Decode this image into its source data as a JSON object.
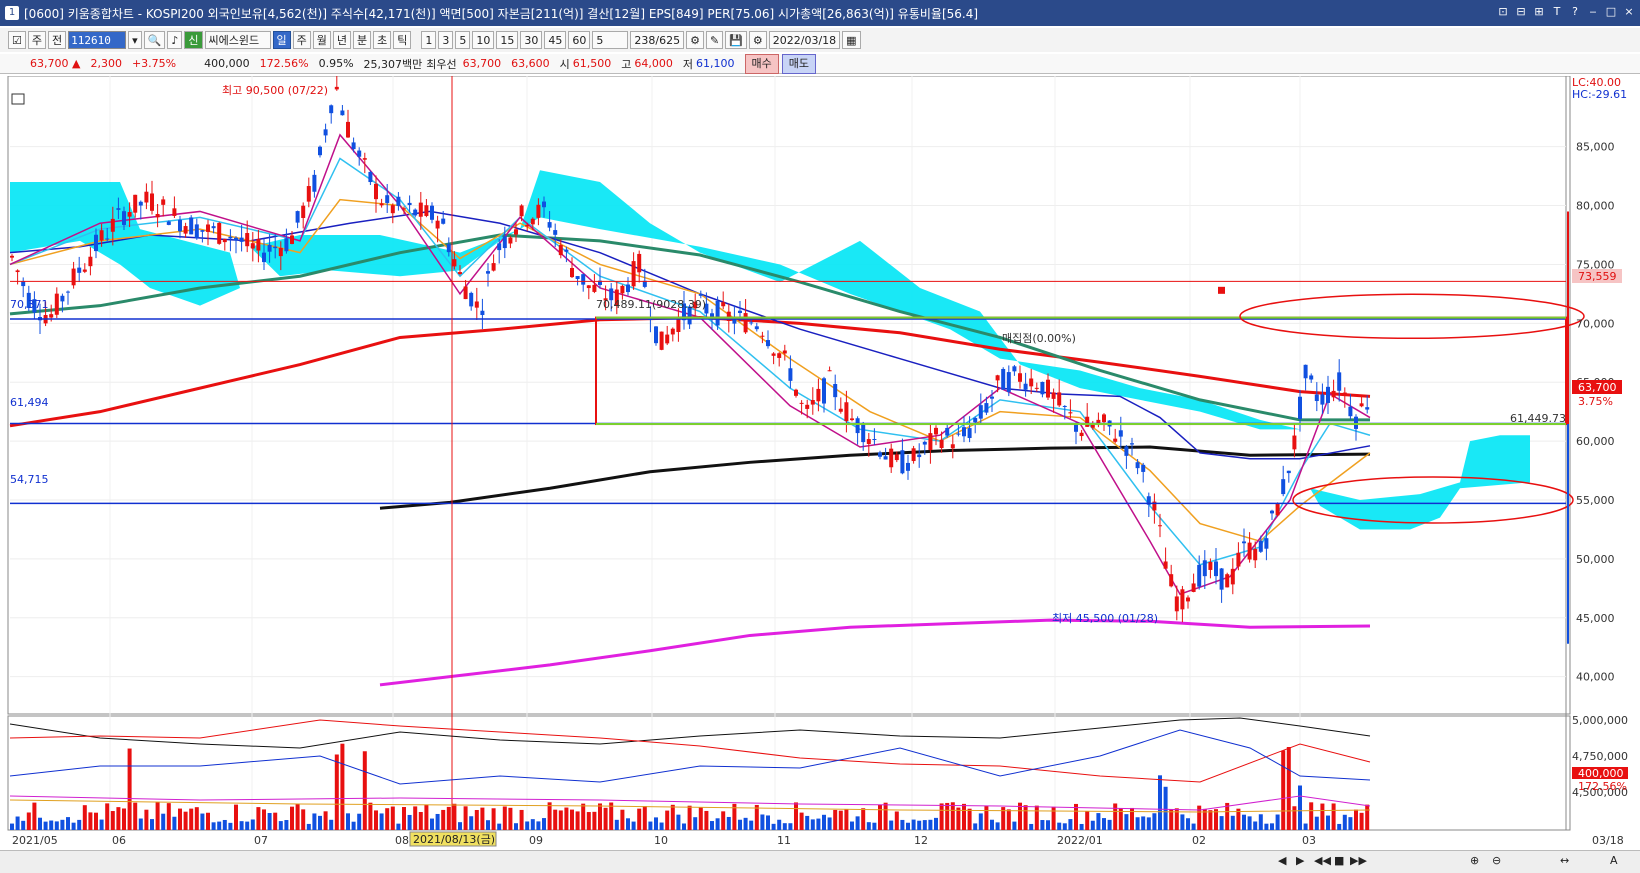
{
  "window": {
    "title": "[0600] 키움종합차트 - KOSPI200 외국인보유[4,562(천)] 주식수[42,171(천)] 액면[500] 자본금[211(억)] 결산[12월] EPS[849] PER[75.06] 시가총액[26,863(억)] 유통비율[56.4]",
    "icon_label": "1",
    "buttons": [
      "⊡",
      "⊟",
      "⊞",
      "T",
      "?",
      "‒",
      "□",
      "×"
    ]
  },
  "toolbar": {
    "btn1": "주",
    "btn2": "전",
    "code": "112610",
    "stock_name": "씨에스윈드",
    "new_badge": "신",
    "periods": [
      "일",
      "주",
      "월",
      "년",
      "분",
      "초",
      "틱"
    ],
    "intervals": [
      "1",
      "3",
      "5",
      "10",
      "15",
      "30",
      "45",
      "60"
    ],
    "count": "5",
    "page": "238/625",
    "date": "2022/03/18"
  },
  "quote": {
    "price": "63,700",
    "change": "2,300",
    "change_pct": "+3.75%",
    "volume": "400,000",
    "vol_ratio": "172.56%",
    "turnover": "0.95%",
    "amount": "25,307백만",
    "best_ask_label": "최우선",
    "best_ask": "63,700",
    "best_bid": "63,600",
    "open_label": "시",
    "open": "61,500",
    "high_label": "고",
    "high": "64,000",
    "low_label": "저",
    "low": "61,100",
    "buy_label": "매수",
    "sell_label": "매도"
  },
  "annotations": {
    "high_note": "최고 90,500 (07/22)",
    "low_note": "최저 45,500 (01/28)",
    "lc": "LC:40.00",
    "hc": "HC:-29.61",
    "box_label": "70,489.11(9028.39)",
    "buy_tag": "매집점(0.00%)",
    "line_70371": "70,371",
    "line_61494": "61,494",
    "line_54715": "54,715",
    "line_61449": "61,449.73",
    "price_tag": "73,559",
    "cur_tag": "63,700",
    "cur_pct": "3.75%",
    "vol_tag": "400,000",
    "vol_pct": "172.56%",
    "crosshair_date": "2021/08/13(금)"
  },
  "chart_data": {
    "type": "candlestick",
    "y_axis": [
      "85,000",
      "80,000",
      "75,000",
      "70,000",
      "65,000",
      "60,000",
      "55,000",
      "50,000",
      "45,000",
      "40,000"
    ],
    "y_values": [
      85000,
      80000,
      75000,
      70000,
      65000,
      60000,
      55000,
      50000,
      45000,
      40000
    ],
    "volume_axis": [
      "5,000,000",
      "4,750,000",
      "4,500,000"
    ],
    "x_axis": [
      "2021/05",
      "06",
      "07",
      "08",
      "09",
      "10",
      "11",
      "12",
      "2022/01",
      "02",
      "03",
      "03/18"
    ],
    "ylim": [
      37000,
      91000
    ],
    "high": 90500,
    "low": 45500,
    "last": 63700
  },
  "status": {
    "controls": [
      "◀",
      "▶",
      "◀◀",
      "■",
      "▶▶",
      "⊕",
      "⊖",
      "↔",
      "A"
    ]
  },
  "colors": {
    "ichimoku": "#00e5f5",
    "ma_red": "#e81010",
    "ma_black": "#111111",
    "ma_magenta": "#e020e0",
    "ma_green": "#2a8a6a",
    "ma_blue": "#1a20c0",
    "ma_orange": "#f0a020",
    "ma_sky": "#30c0f0",
    "up": "#e81010",
    "down": "#1050e0"
  }
}
